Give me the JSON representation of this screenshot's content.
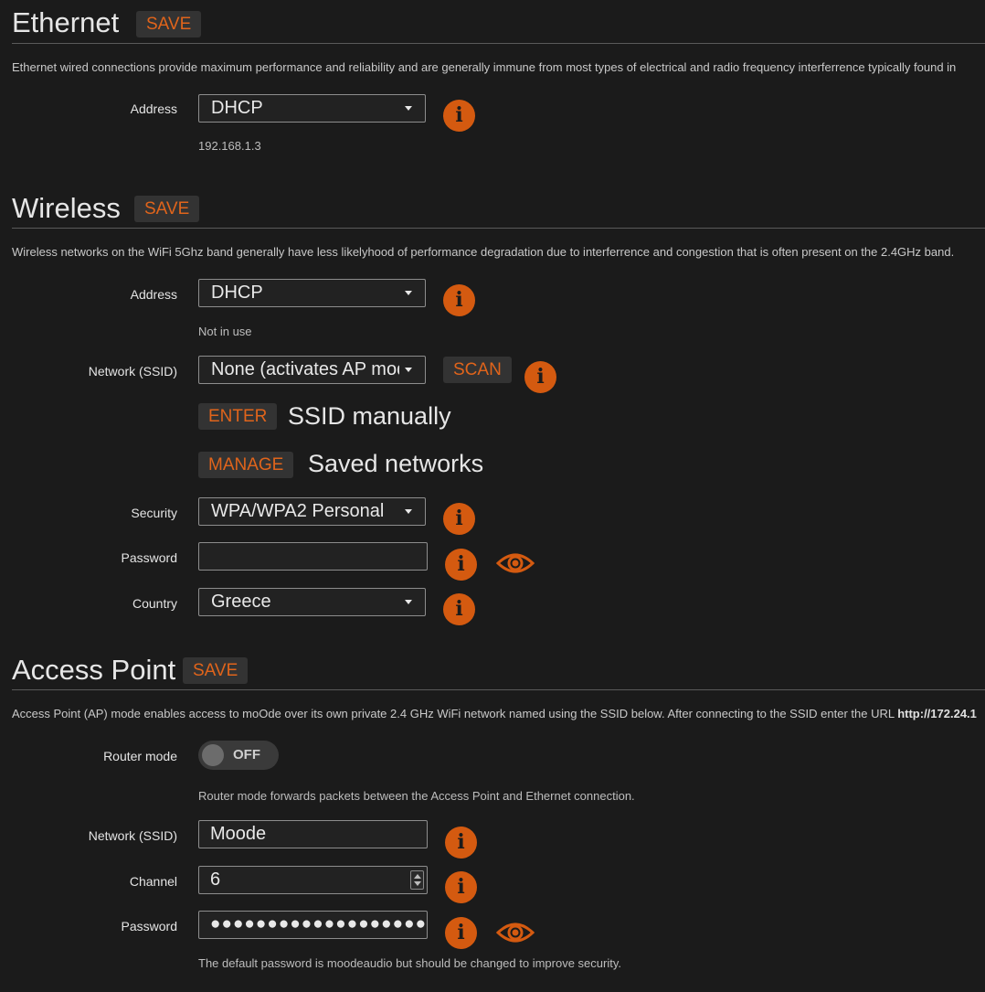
{
  "ethernet": {
    "title": "Ethernet",
    "save_label": "SAVE",
    "description": "Ethernet wired connections provide maximum performance and reliability and are generally immune from most types of electrical and radio frequency interferrence typically found in",
    "address_label": "Address",
    "address_value": "DHCP",
    "ip": "192.168.1.3"
  },
  "wireless": {
    "title": "Wireless",
    "save_label": "SAVE",
    "description": "Wireless networks on the WiFi 5Ghz band generally have less likelyhood of performance degradation due to interferrence and congestion that is often present on the 2.4GHz band.",
    "address_label": "Address",
    "address_value": "DHCP",
    "address_status": "Not in use",
    "ssid_label": "Network (SSID)",
    "ssid_value": "None (activates AP mode)",
    "scan_label": "SCAN",
    "enter_label": "ENTER",
    "enter_text": "SSID manually",
    "manage_label": "MANAGE",
    "manage_text": "Saved networks",
    "security_label": "Security",
    "security_value": "WPA/WPA2 Personal",
    "password_label": "Password",
    "password_value": "",
    "country_label": "Country",
    "country_value": "Greece"
  },
  "ap": {
    "title": "Access Point",
    "save_label": "SAVE",
    "description_prefix": "Access Point (AP) mode enables access to moOde over its own private 2.4 GHz WiFi network named using the SSID below. After connecting to the SSID enter the URL ",
    "description_url": "http://172.24.1",
    "router_label": "Router mode",
    "router_state": "OFF",
    "router_help": "Router mode forwards packets between the Access Point and Ethernet connection.",
    "ssid_label": "Network (SSID)",
    "ssid_value": "Moode",
    "channel_label": "Channel",
    "channel_value": "6",
    "password_label": "Password",
    "password_mask": "●●●●●●●●●●●●●●●●●●●●",
    "password_help": "The default password is moodeaudio but should be changed to improve security."
  },
  "icons": {
    "info": "info-icon",
    "eye": "eye-icon",
    "caret": "chevron-down-icon"
  },
  "colors": {
    "background": "#1b1b1b",
    "accent": "#e0641b",
    "info_circle": "#d45a10",
    "button_bg": "#333333",
    "field_border": "#8d8d8d"
  }
}
